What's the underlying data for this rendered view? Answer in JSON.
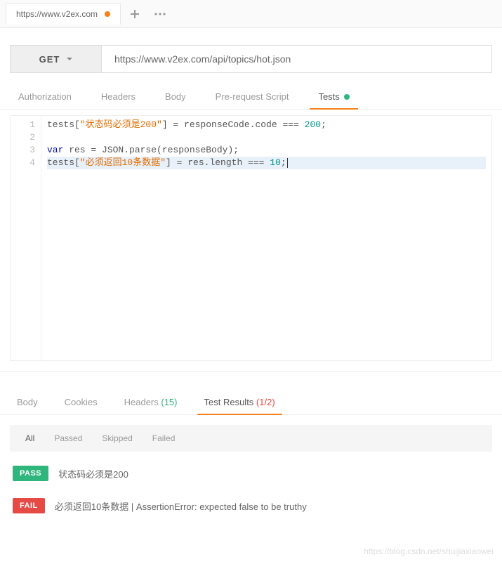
{
  "tabBar": {
    "requestTabLabel": "https://www.v2ex.com"
  },
  "requestBar": {
    "method": "GET",
    "url": "https://www.v2ex.com/api/topics/hot.json"
  },
  "requestTabs": {
    "authorization": "Authorization",
    "headers": "Headers",
    "body": "Body",
    "prerequest": "Pre-request Script",
    "tests": "Tests"
  },
  "editor": {
    "lines": [
      "1",
      "2",
      "3",
      "4"
    ],
    "l1_a": "tests[",
    "l1_str": "\"状态码必须是200\"",
    "l1_b": "] = responseCode.code === ",
    "l1_num": "200",
    "l1_c": ";",
    "l3_kw": "var",
    "l3_a": " res = JSON.parse(responseBody);",
    "l4_a": "tests[",
    "l4_str": "\"必须返回10条数据\"",
    "l4_b": "] = res.length === ",
    "l4_num": "10",
    "l4_c": ";"
  },
  "responseTabs": {
    "body": "Body",
    "cookies": "Cookies",
    "headers": "Headers",
    "headersCount": "(15)",
    "testResults": "Test Results",
    "testResultsCount": "(1/2)"
  },
  "filters": {
    "all": "All",
    "passed": "Passed",
    "skipped": "Skipped",
    "failed": "Failed"
  },
  "results": {
    "pass_badge": "PASS",
    "pass_msg": "状态码必须是200",
    "fail_badge": "FAIL",
    "fail_msg": "必须返回10条数据 | AssertionError: expected false to be truthy"
  },
  "watermark": "https://blog.csdn.net/shuijiaxiaowei"
}
